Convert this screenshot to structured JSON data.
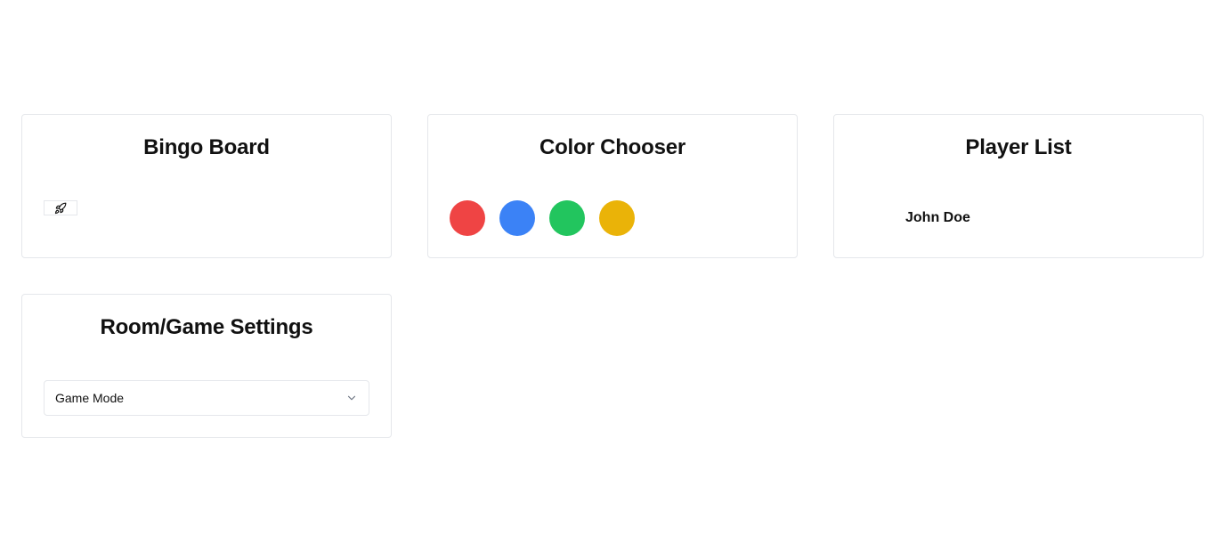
{
  "bingo_board": {
    "title": "Bingo Board",
    "cell_icon": "rocket-icon"
  },
  "color_chooser": {
    "title": "Color Chooser",
    "colors": [
      "#ef4444",
      "#3b82f6",
      "#22c55e",
      "#eab308"
    ]
  },
  "player_list": {
    "title": "Player List",
    "players": [
      "John Doe"
    ]
  },
  "settings": {
    "title": "Room/Game Settings",
    "game_mode_select": {
      "value": "Game Mode",
      "icon": "chevron-down-icon"
    }
  }
}
